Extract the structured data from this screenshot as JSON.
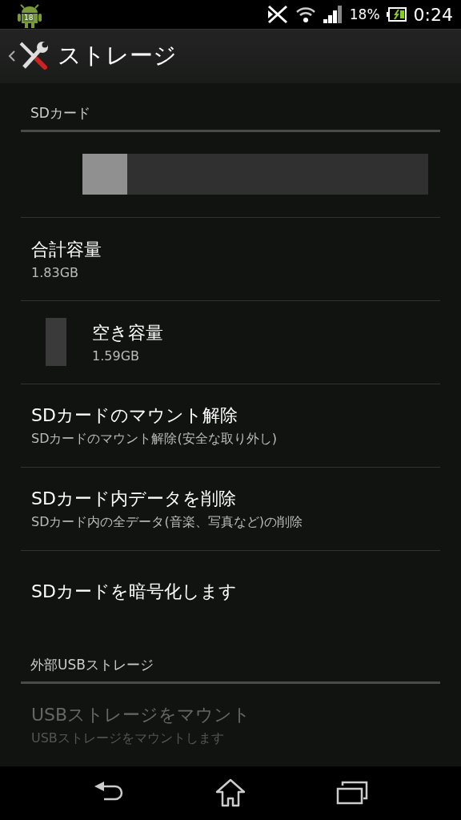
{
  "status_bar": {
    "notification_badge": "18",
    "battery": "18%",
    "time": "0:24"
  },
  "action_bar": {
    "title": "ストレージ"
  },
  "sections": [
    {
      "header": "SDカード",
      "items": [
        {
          "kind": "bar",
          "level": 0.13
        },
        {
          "kind": "info",
          "title": "合計容量",
          "subtitle": "1.83GB",
          "disabled": false
        },
        {
          "kind": "legend",
          "title": "空き容量",
          "subtitle": "1.59GB",
          "disabled": false
        },
        {
          "kind": "action",
          "title": "SDカードのマウント解除",
          "subtitle": "SDカードのマウント解除(安全な取り外し)",
          "disabled": false
        },
        {
          "kind": "action",
          "title": "SDカード内データを削除",
          "subtitle": "SDカード内の全データ(音楽、写真など)の削除",
          "disabled": false
        },
        {
          "kind": "action",
          "title": "SDカードを暗号化します",
          "disabled": false
        }
      ]
    },
    {
      "header": "外部USBストレージ",
      "items": [
        {
          "kind": "action",
          "title": "USBストレージをマウント",
          "subtitle": "USBストレージをマウントします",
          "disabled": true
        }
      ]
    }
  ]
}
